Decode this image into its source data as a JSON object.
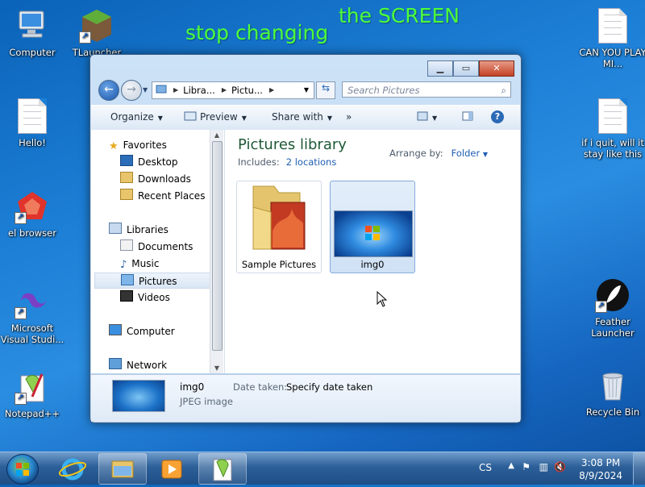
{
  "desktop": {
    "overlay_text": [
      "stop changing",
      "the SCREEN"
    ],
    "icons_left": [
      {
        "label": "Computer",
        "icon": "computer-icon"
      },
      {
        "label": "Hello!",
        "icon": "text-document-icon"
      },
      {
        "label": "el browser",
        "icon": "browser-icon"
      },
      {
        "label": "Microsoft Visual Studi...",
        "icon": "visual-studio-icon"
      },
      {
        "label": "Notepad++",
        "icon": "notepad-plus-plus-icon"
      }
    ],
    "icons_top": [
      {
        "label": "TLauncher",
        "icon": "minecraft-icon"
      }
    ],
    "icons_right": [
      {
        "label": "CAN YOU PLAY MI...",
        "icon": "text-document-icon"
      },
      {
        "label": "if i quit, will it stay like this",
        "icon": "text-document-icon"
      },
      {
        "label": "Feather Launcher",
        "icon": "feather-icon"
      },
      {
        "label": "Recycle Bin",
        "icon": "recycle-bin-icon"
      }
    ]
  },
  "window": {
    "breadcrumb": [
      "Libra...",
      "Pictu..."
    ],
    "search_placeholder": "Search Pictures",
    "toolbar": {
      "organize": "Organize",
      "preview": "Preview",
      "share": "Share with",
      "more": "»"
    },
    "nav": {
      "favorites": "Favorites",
      "favorites_items": [
        "Desktop",
        "Downloads",
        "Recent Places"
      ],
      "libraries": "Libraries",
      "libraries_items": [
        "Documents",
        "Music",
        "Pictures",
        "Videos"
      ],
      "computer": "Computer",
      "network": "Network"
    },
    "library": {
      "title": "Pictures library",
      "includes_label": "Includes:",
      "includes_link": "2 locations",
      "arrange_label": "Arrange by:",
      "arrange_value": "Folder"
    },
    "items": [
      {
        "name": "Sample Pictures",
        "type": "folder"
      },
      {
        "name": "img0",
        "type": "image",
        "selected": true
      }
    ],
    "details": {
      "name": "img0",
      "type": "JPEG image",
      "date_label": "Date taken:",
      "date_value": "Specify date taken"
    }
  },
  "taskbar": {
    "lang": "CS",
    "time": "3:08 PM",
    "date": "8/9/2024"
  }
}
